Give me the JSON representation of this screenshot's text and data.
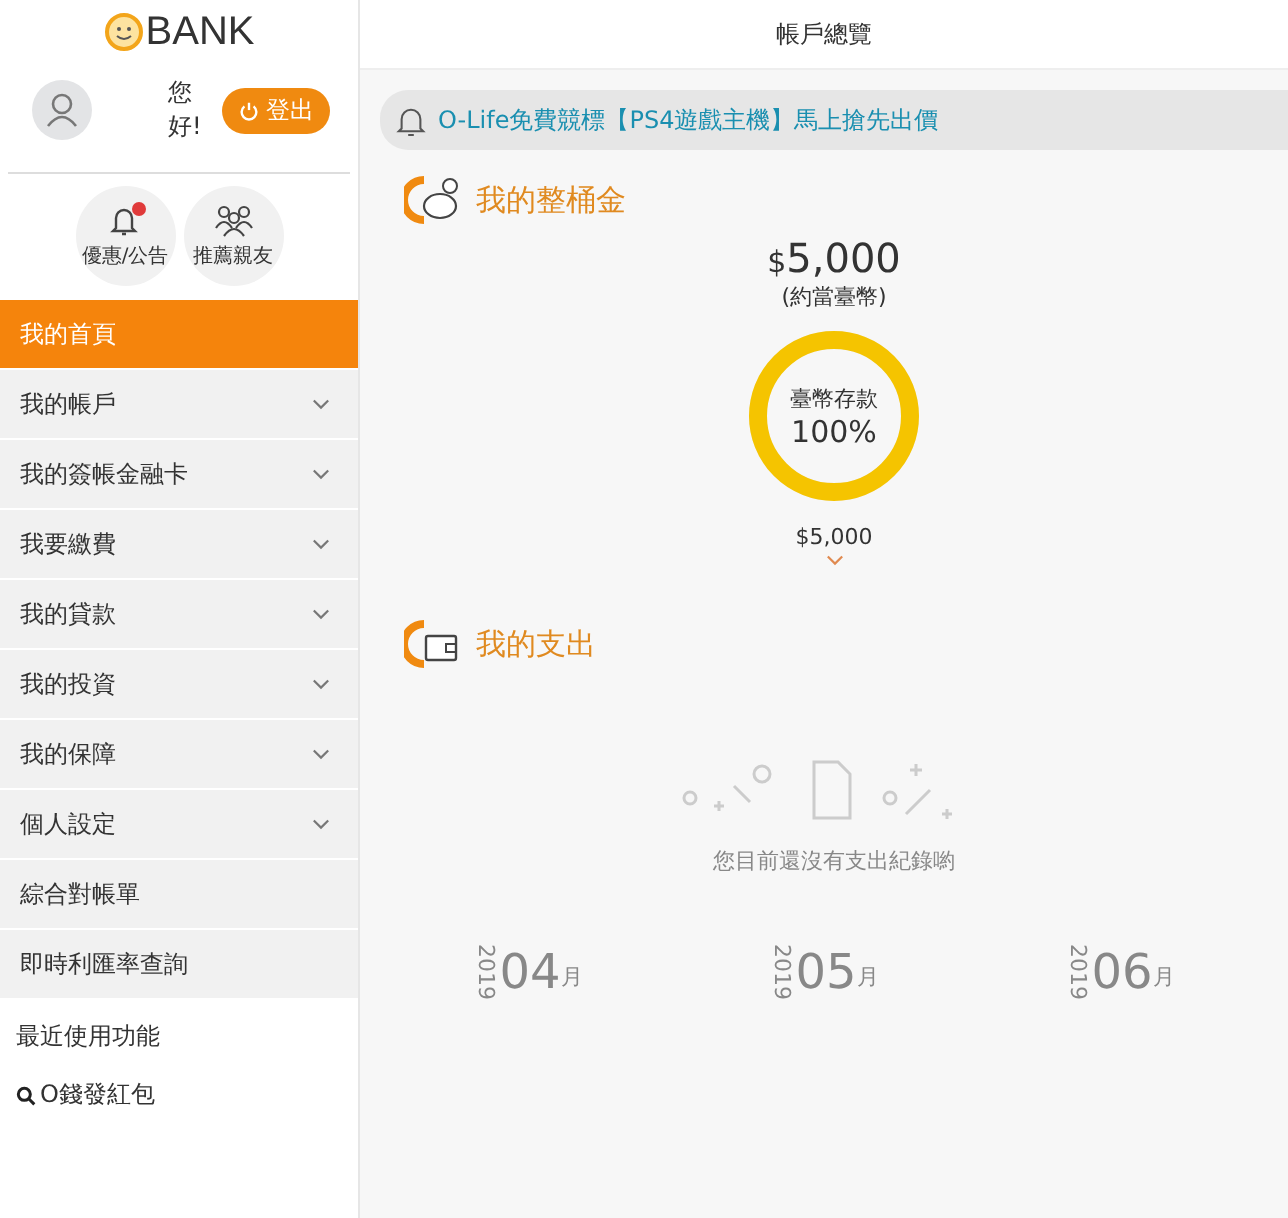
{
  "logo": {
    "text": "BANK"
  },
  "user": {
    "greeting": "您好!",
    "logout": "登出"
  },
  "quick_links": [
    {
      "label": "優惠/公告",
      "kind": "bell",
      "badge": true
    },
    {
      "label": "推薦親友",
      "kind": "people",
      "badge": false
    }
  ],
  "menu": [
    {
      "label": "我的首頁",
      "selected": true,
      "expandable": false
    },
    {
      "label": "我的帳戶",
      "selected": false,
      "expandable": true
    },
    {
      "label": "我的簽帳金融卡",
      "selected": false,
      "expandable": true
    },
    {
      "label": "我要繳費",
      "selected": false,
      "expandable": true
    },
    {
      "label": "我的貸款",
      "selected": false,
      "expandable": true
    },
    {
      "label": "我的投資",
      "selected": false,
      "expandable": true
    },
    {
      "label": "我的保障",
      "selected": false,
      "expandable": true
    },
    {
      "label": "個人設定",
      "selected": false,
      "expandable": true
    },
    {
      "label": "綜合對帳單",
      "selected": false,
      "expandable": false
    },
    {
      "label": "即時利匯率查詢",
      "selected": false,
      "expandable": false
    }
  ],
  "recent": {
    "title": "最近使用功能",
    "items": [
      "O錢發紅包"
    ]
  },
  "header": {
    "title": "帳戶總覽"
  },
  "notice": {
    "text": "O-Life免費競標【PS4遊戲主機】馬上搶先出價"
  },
  "savings": {
    "title": "我的整桶金",
    "amount_symbol": "$",
    "amount": "5,000",
    "note": "(約當臺幣)",
    "gauge_label": "臺幣存款",
    "gauge_percent": "100%",
    "level": 1,
    "subtotal": "$5,000"
  },
  "spending": {
    "title": "我的支出",
    "empty_text": "您目前還沒有支出紀錄喲",
    "months": [
      {
        "year": "2019",
        "month": "04",
        "unit": "月"
      },
      {
        "year": "2019",
        "month": "05",
        "unit": "月"
      },
      {
        "year": "2019",
        "month": "06",
        "unit": "月"
      }
    ]
  }
}
